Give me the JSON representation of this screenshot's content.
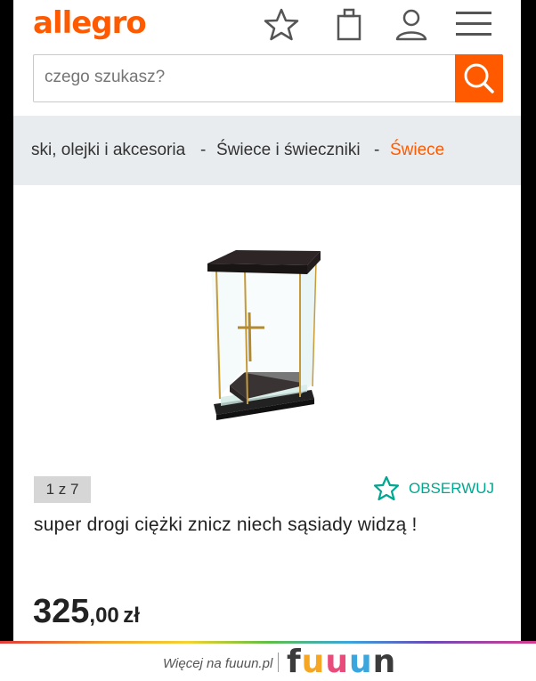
{
  "header": {
    "logo": "allegro",
    "icons": [
      "star-icon",
      "shopping-bag-icon",
      "user-icon",
      "menu-icon"
    ]
  },
  "search": {
    "placeholder": "czego szukasz?"
  },
  "breadcrumb": {
    "items": [
      "ski, olejki i akcesoria",
      "Świece i świeczniki",
      "Świece"
    ],
    "separator": "-"
  },
  "gallery": {
    "counter": "1 z 7"
  },
  "actions": {
    "observe_label": "OBSERWUJ"
  },
  "product": {
    "title": "super drogi ciężki znicz niech sąsiady widzą !",
    "price_integer": "325",
    "price_fraction": ",00",
    "currency": "zł"
  },
  "footer": {
    "more_text": "Więcej na fuuun.pl",
    "brand": "fuuun"
  },
  "colors": {
    "accent": "#ff5a00",
    "observe": "#00a790",
    "breadcrumb_bg": "#e8ecef"
  }
}
